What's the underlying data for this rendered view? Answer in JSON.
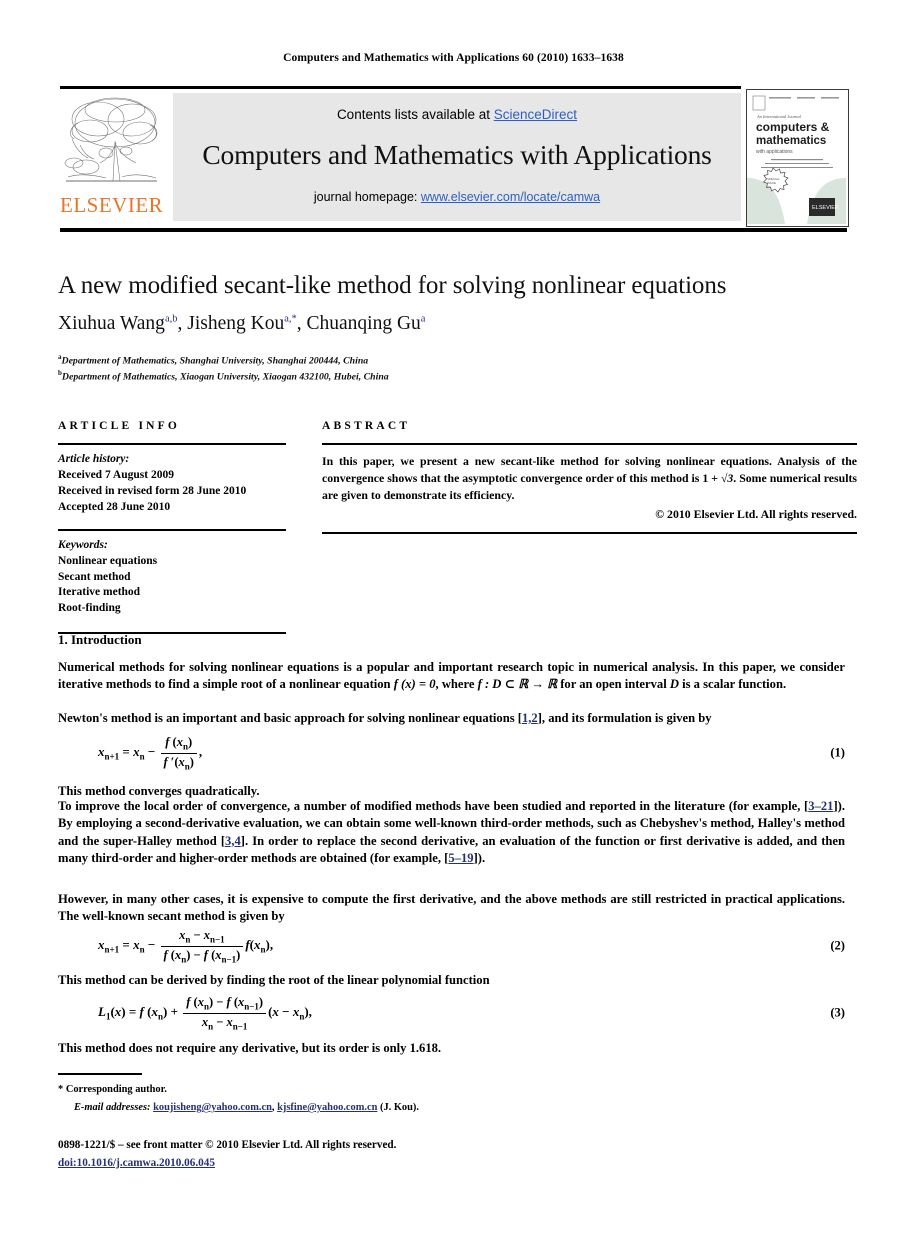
{
  "running_head": "Computers and Mathematics with Applications 60 (2010) 1633–1638",
  "header": {
    "publisher_name": "ELSEVIER",
    "contents_prefix": "Contents lists available at ",
    "contents_link": "ScienceDirect",
    "journal_title": "Computers and Mathematics with Applications",
    "homepage_prefix": "journal homepage: ",
    "homepage_link": "www.elsevier.com/locate/camwa",
    "cover": {
      "line1": "An International Journal",
      "line2": "computers &",
      "line3": "mathematics",
      "line4": "with applications"
    }
  },
  "article": {
    "title": "A new modified secant-like method for solving nonlinear equations",
    "authors": [
      {
        "name": "Xiuhua Wang",
        "sup": "a,b",
        "sep": ", "
      },
      {
        "name": "Jisheng Kou",
        "sup": "a,*",
        "sep": ", "
      },
      {
        "name": "Chuanqing Gu",
        "sup": "a",
        "sep": ""
      }
    ],
    "affiliations": [
      {
        "mark": "a",
        "text": "Department of Mathematics, Shanghai University, Shanghai 200444, China"
      },
      {
        "mark": "b",
        "text": "Department of Mathematics, Xiaogan University, Xiaogan 432100, Hubei, China"
      }
    ]
  },
  "info": {
    "heading": "ARTICLE INFO",
    "history_label": "Article history:",
    "history": [
      "Received 7 August 2009",
      "Received in revised form 28 June 2010",
      "Accepted 28 June 2010"
    ],
    "keywords_label": "Keywords:",
    "keywords": [
      "Nonlinear equations",
      "Secant method",
      "Iterative method",
      "Root-finding"
    ]
  },
  "abstract": {
    "heading": "ABSTRACT",
    "text_part1": "In this paper, we present a new secant-like method for solving nonlinear equations. Analysis of the convergence shows that the asymptotic convergence order of this method is 1 + ",
    "text_sqrt": "√3",
    "text_part2": ". Some numerical results are given to demonstrate its efficiency.",
    "copyright": "© 2010 Elsevier Ltd. All rights reserved."
  },
  "body": {
    "section_number": "1.",
    "section_title": "Introduction",
    "p1_a": "Numerical methods for solving nonlinear equations is a popular and  important research topic in numerical analysis. In this paper, we consider iterative methods to find a simple root of a nonlinear equation ",
    "p1_eq": "f (x) = 0",
    "p1_b": ", where ",
    "p1_eq2": "f : D ⊂ ℝ → ℝ",
    "p1_c": " for an open interval ",
    "p1_eq3": "D",
    "p1_d": " is a scalar function.",
    "p2_a": "Newton's method is an important and basic approach for solving nonlinear equations [",
    "p2_ref": "1,2",
    "p2_b": "], and its formulation is given by",
    "p3": "This method converges quadratically.",
    "p4_a": "To improve the local order of convergence, a number of modified methods have been studied and reported in the literature (for example, [",
    "p4_ref1": "3–21",
    "p4_b": "]). By employing a second-derivative evaluation, we can obtain some well-known third-order methods, such as Chebyshev's method, Halley's method and the super-Halley method [",
    "p4_ref2": "3,4",
    "p4_c": "]. In order to replace the second derivative, an evaluation of the function or first derivative is added, and then many third-order and higher-order methods are obtained (for example, [",
    "p4_ref3": "5–19",
    "p4_d": "]).",
    "p5": "However, in many other cases, it is expensive to compute the first derivative, and the above methods are still restricted in practical applications. The well-known secant method is given by",
    "p6": "This method can be derived by finding the root of the linear polynomial function",
    "p7": "This method does not require any derivative, but its order is only 1.618."
  },
  "equations": {
    "eq1": {
      "number": "(1)",
      "lhs": "x",
      "lhs_sub": "n+1",
      "eq": "=",
      "term1": "x",
      "term1_sub": "n",
      "minus": "−",
      "num": "f (x",
      "num_sub": "n",
      "num_end": ")",
      "den": "f ′(x",
      "den_sub": "n",
      "den_end": ")",
      "tail": ","
    },
    "eq2": {
      "number": "(2)"
    },
    "eq3": {
      "number": "(3)"
    }
  },
  "footer": {
    "corresponding_mark": "*",
    "corresponding_text": "Corresponding author.",
    "email_label": "E-mail addresses:",
    "email1": "koujisheng@yahoo.com.cn",
    "email_sep": ", ",
    "email2": "kjsfine@yahoo.com.cn",
    "email_suffix": " (J. Kou).",
    "issn_line": "0898-1221/$ – see front matter © 2010 Elsevier Ltd. All rights reserved.",
    "doi_line": "doi:10.1016/j.camwa.2010.06.045"
  },
  "colors": {
    "link": "#2b5fc4",
    "reference": "#24307a",
    "elsevier_orange": "#E8752A",
    "band_bg": "#e7e7e7"
  }
}
